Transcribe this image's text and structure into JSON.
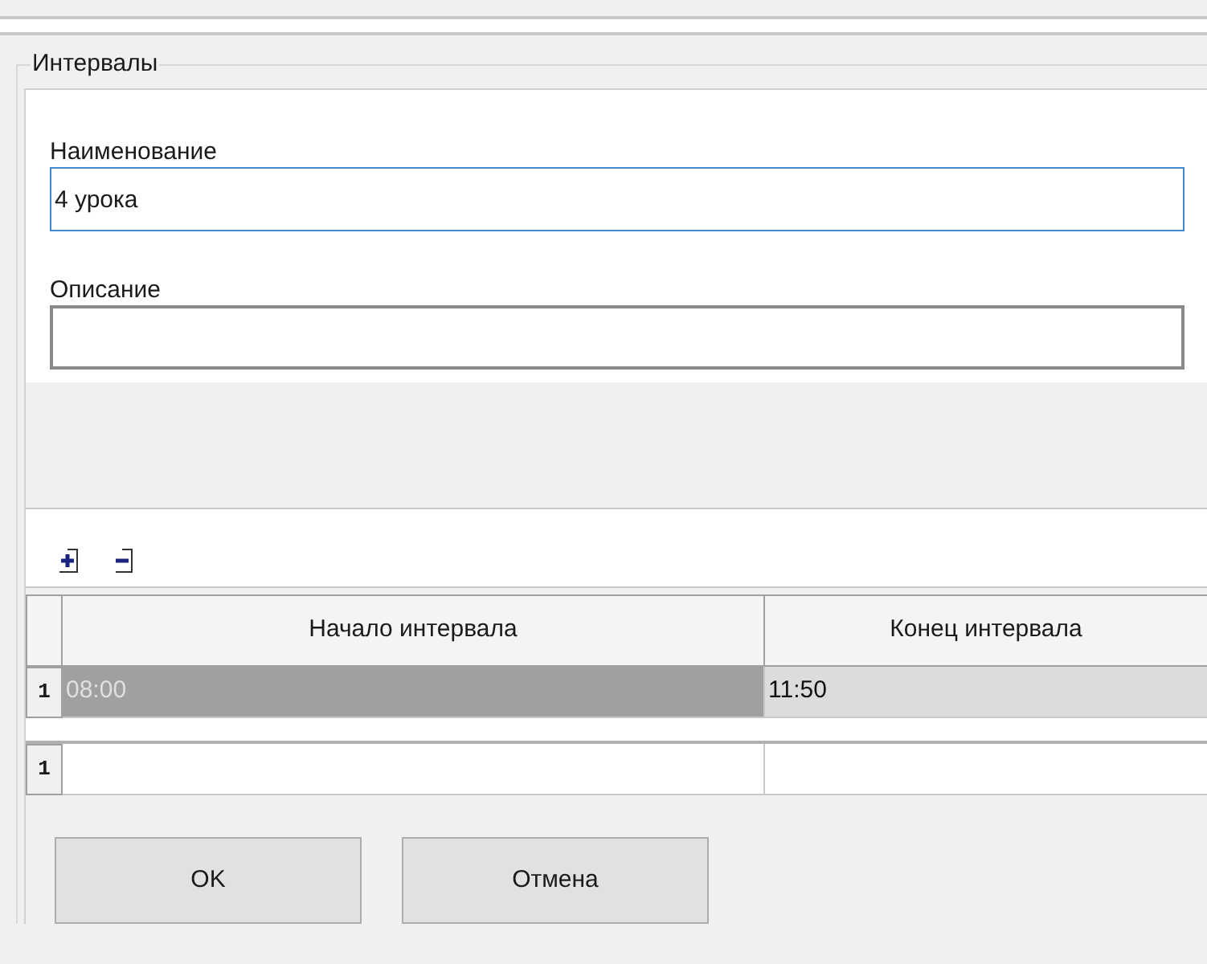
{
  "group": {
    "title": "Интервалы"
  },
  "fields": [
    {
      "label": "Наименование",
      "value": "4 урока",
      "focused": true
    },
    {
      "label": "Описание",
      "focused": false
    }
  ],
  "grid": {
    "columns": [
      "Начало интервала",
      "Конец интервала"
    ],
    "rows": [
      {
        "number": "1",
        "cells": [
          "08:00",
          "11:50"
        ],
        "selected": true
      }
    ],
    "new_row": {
      "number": "1"
    }
  },
  "buttons": [
    "OK",
    "Отмена"
  ]
}
